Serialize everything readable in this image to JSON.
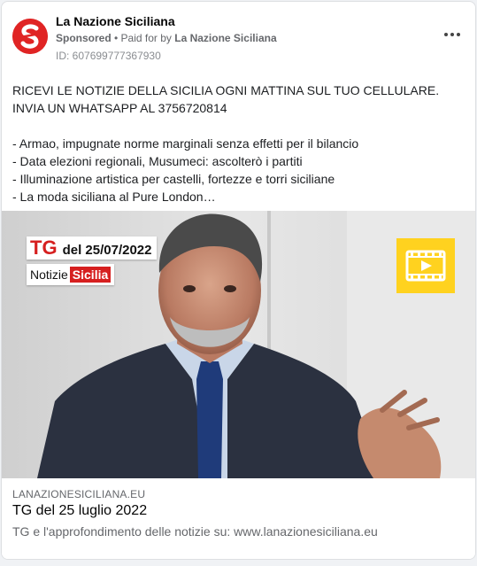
{
  "page": {
    "name": "La Nazione Siciliana",
    "sponsored_label": "Sponsored",
    "paid_for_by_prefix": " • Paid for by ",
    "paid_for_by_name": "La Nazione Siciliana",
    "ad_id": "ID: 607699777367930",
    "avatar_letter": "S",
    "avatar_icon": "la-nazione-siciliana-logo",
    "more_icon": "more-options-icon"
  },
  "post": {
    "headline": "RICEVI LE NOTIZIE DELLA SICILIA OGNI MATTINA SUL TUO CELLULARE. INVIA UN WHATSAPP AL 3756720814",
    "bullets": [
      "- Armao, impugnate norme marginali senza effetti per il bilancio",
      "- Data elezioni regionali, Musumeci: ascolterò i partiti",
      "- Illuminazione artistica per castelli, fortezze e torri siciliane",
      "- La moda siciliana al Pure London…"
    ]
  },
  "media": {
    "tg_label": "TG",
    "tg_date": "del 25/07/2022",
    "notizie_label": "Notizie",
    "sicilia_label": "Sicilia",
    "play_icon": "video-play-icon"
  },
  "link": {
    "domain": "LANAZIONESICILIANA.EU",
    "title": "TG del 25 luglio 2022",
    "description": "TG e l'approfondimento delle notizie su: www.lanazionesiciliana.eu"
  },
  "colors": {
    "brand_red": "#e02424",
    "badge_red": "#d61f1f",
    "play_yellow": "#ffd21f",
    "muted_text": "#65676b"
  }
}
